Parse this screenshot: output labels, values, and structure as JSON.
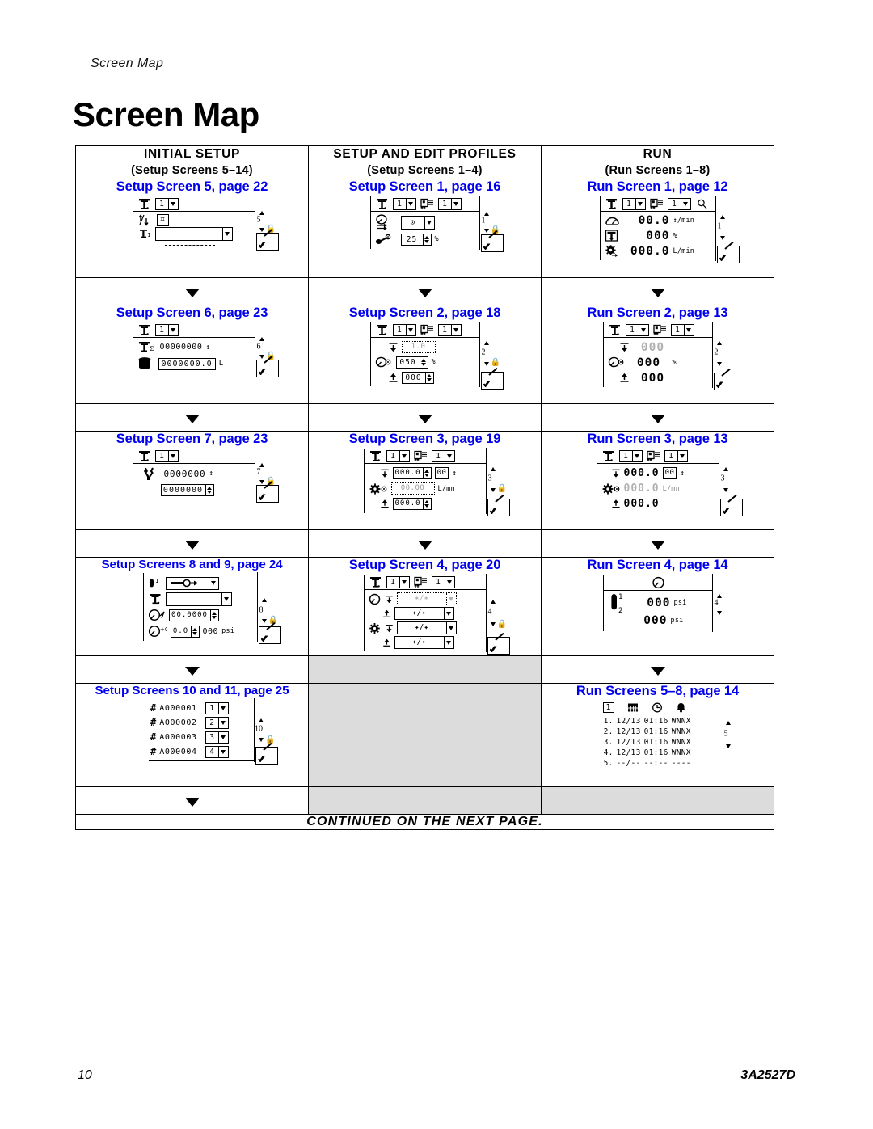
{
  "document": {
    "running_header": "Screen Map",
    "title": "Screen Map",
    "footer_page": "10",
    "footer_doc": "3A2527D",
    "continued_note": "CONTINUED ON THE NEXT PAGE.",
    "link_color": "#0000EE",
    "shaded_color": "#dcdcdc"
  },
  "columns": [
    {
      "heading": "INITIAL  SETUP",
      "subheading": "(Setup Screens 5–14)"
    },
    {
      "heading": "SETUP AND EDIT PROFILES",
      "subheading": "(Setup Screens 1–4)"
    },
    {
      "heading": "RUN",
      "subheading": "(Run Screens 1–8)"
    }
  ],
  "cells": {
    "r1c1": {
      "title": "Setup Screen 5, page 22",
      "nav_number": "5",
      "top_selector": "1",
      "fields": [
        "",
        ""
      ],
      "dashes": "---------"
    },
    "r1c2": {
      "title": "Setup Screen 1, page 16",
      "nav_number": "1",
      "top_selector_a": "1",
      "top_selector_b": "1",
      "clock_value": "",
      "percent_value": "25",
      "percent_unit": "%"
    },
    "r1c3": {
      "title": "Run Screen 1, page 12",
      "nav_number": "1",
      "top_selector_a": "1",
      "top_selector_b": "1",
      "rows": [
        {
          "value": "00.0",
          "unit": "↕/min"
        },
        {
          "value": "000",
          "unit": "%"
        },
        {
          "value": "000.0",
          "unit": "L/min"
        }
      ]
    },
    "r2c1": {
      "title": "Setup Screen 6, page 23",
      "nav_number": "6",
      "top_selector": "1",
      "counter": "00000000",
      "volume": "0000000.0",
      "volume_unit": "L"
    },
    "r2c2": {
      "title": "Setup Screen 2, page 18",
      "nav_number": "2",
      "top_selector_a": "1",
      "top_selector_b": "1",
      "row1": "1.0",
      "row2": "050",
      "row2_unit": "%",
      "row3": "000"
    },
    "r2c3": {
      "title": "Run Screen 2, page 13",
      "nav_number": "2",
      "top_selector_a": "1",
      "top_selector_b": "1",
      "row1": "000",
      "row2": "000",
      "row2_unit": "%",
      "row3": "000"
    },
    "r3c1": {
      "title": "Setup Screen 7, page 23",
      "nav_number": "7",
      "top_selector": "1",
      "row1": "0000000",
      "row2": "0000000"
    },
    "r3c2": {
      "title": "Setup Screen 3, page 19",
      "nav_number": "3",
      "top_selector_a": "1",
      "top_selector_b": "1",
      "row1a": "000.0",
      "row1b": "00",
      "row2": "00.00",
      "row2_unit": "L/mn",
      "row3": "000.0"
    },
    "r3c3": {
      "title": "Run Screen 3, page 13",
      "nav_number": "3",
      "top_selector_a": "1",
      "top_selector_b": "1",
      "row1a": "000.0",
      "row1b": "00",
      "row2": "000.0",
      "row2_unit": "L/mn",
      "row3": "000.0"
    },
    "r4c1": {
      "title": "Setup Screens 8 and 9, page 24",
      "nav_number": "8",
      "row1_label": "1",
      "row3_value": "00.0000",
      "row4_value": "0.0",
      "row4_value2": "000",
      "row4_unit": "psi"
    },
    "r4c2": {
      "title": "Setup Screen 4, page 20",
      "nav_number": "4",
      "top_selector_a": "1",
      "top_selector_b": "1",
      "rows": [
        "✶/✶",
        "✦/✦",
        "✦/✦",
        "✦/✦"
      ]
    },
    "r4c3": {
      "title": "Run Screen 4, page 14",
      "nav_number": "4",
      "rows": [
        {
          "idx": "1",
          "value": "000",
          "unit": "psi"
        },
        {
          "idx": "2",
          "value": "000",
          "unit": "psi"
        }
      ]
    },
    "r5c1": {
      "title": "Setup Screens 10 and 11, page 25",
      "nav_number": "10",
      "rows": [
        {
          "code": "A000001",
          "sel": "1"
        },
        {
          "code": "A000002",
          "sel": "2"
        },
        {
          "code": "A000003",
          "sel": "3"
        },
        {
          "code": "A000004",
          "sel": "4"
        }
      ]
    },
    "r5c2": {
      "title": "",
      "shaded": true
    },
    "r5c3": {
      "title": "Run Screens 5–8, page 14",
      "nav_number": "5",
      "header_selector": "1",
      "rows": [
        {
          "idx": "1.",
          "date": "12/13",
          "time": "01:16",
          "code": "WNNX"
        },
        {
          "idx": "2.",
          "date": "12/13",
          "time": "01:16",
          "code": "WNNX"
        },
        {
          "idx": "3.",
          "date": "12/13",
          "time": "01:16",
          "code": "WNNX"
        },
        {
          "idx": "4.",
          "date": "12/13",
          "time": "01:16",
          "code": "WNNX"
        },
        {
          "idx": "5.",
          "date": "--/--",
          "time": "--:--",
          "code": "----"
        }
      ]
    }
  },
  "icons": {
    "pump": "pump-icon",
    "profile": "profile-icon",
    "gauge": "gauge-icon",
    "gear": "gear-icon",
    "wrench": "wrench-icon",
    "tank": "tank-icon",
    "magnifier": "magnifier-icon",
    "lock": "lock-icon",
    "edit": "edit-pencil-icon",
    "arrow_down": "arrow-down-icon",
    "calendar": "calendar-icon",
    "clock": "clock-icon",
    "alarm": "alarm-bell-icon",
    "spray": "spray-gun-icon",
    "hash": "hash-icon"
  }
}
